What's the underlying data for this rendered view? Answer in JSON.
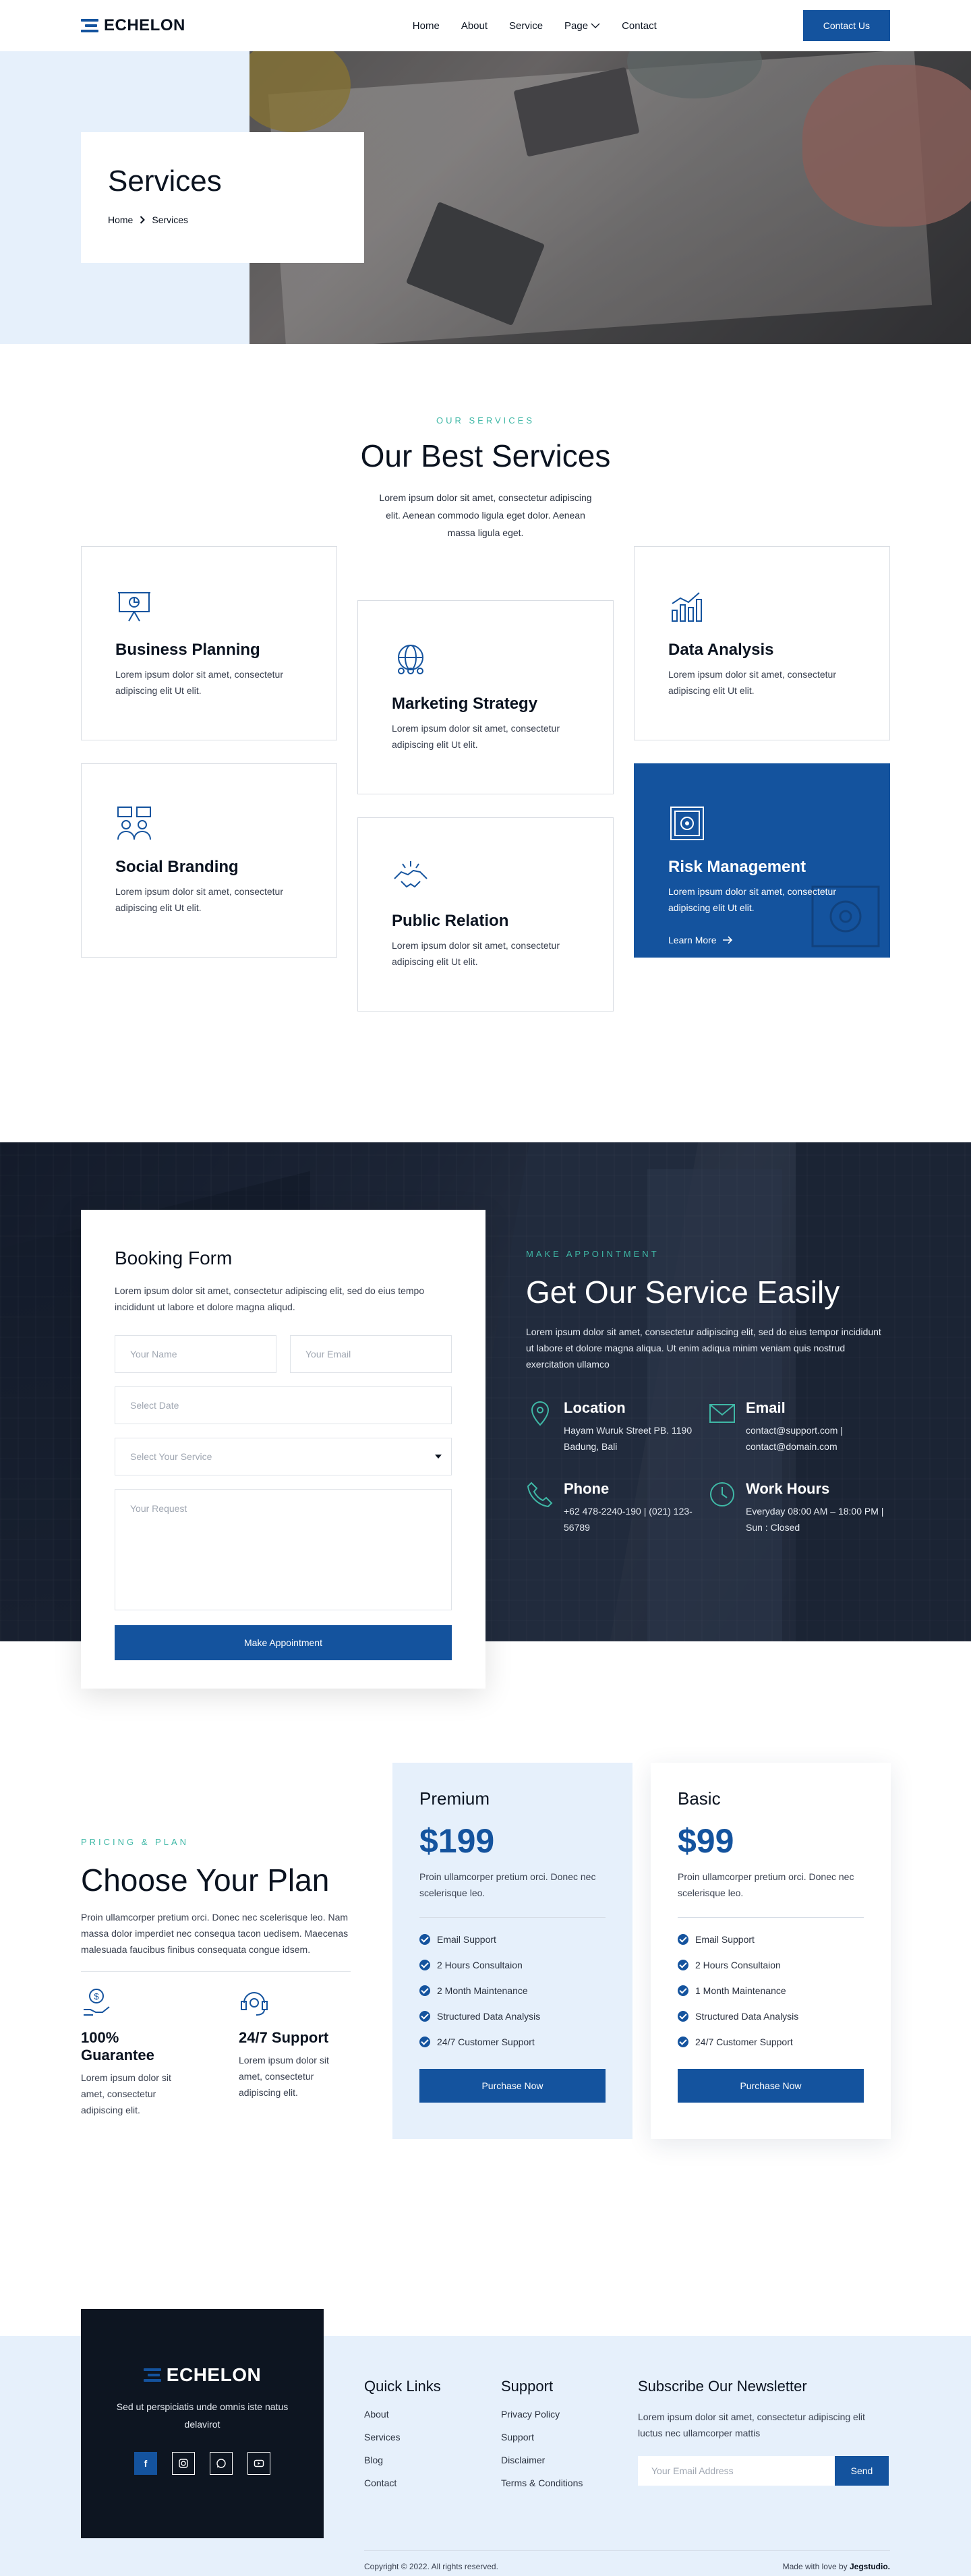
{
  "brand": {
    "name": "ECHELON"
  },
  "nav": {
    "items": [
      "Home",
      "About",
      "Service",
      "Page",
      "Contact"
    ],
    "cta": "Contact Us"
  },
  "hero": {
    "title": "Services",
    "crumb_home": "Home",
    "crumb_current": "Services"
  },
  "services": {
    "eyebrow": "OUR SERVICES",
    "title": "Our Best Services",
    "desc": "Lorem ipsum dolor sit amet, consectetur adipiscing elit. Aenean commodo ligula eget dolor. Aenean massa ligula eget.",
    "cards": [
      {
        "title": "Business Planning",
        "desc": "Lorem ipsum dolor sit amet, consectetur adipiscing elit Ut elit.",
        "icon": "presentation-icon"
      },
      {
        "title": "Marketing Strategy",
        "desc": "Lorem ipsum dolor sit amet, consectetur adipiscing elit Ut elit.",
        "icon": "globe-people-icon"
      },
      {
        "title": "Data Analysis",
        "desc": "Lorem ipsum dolor sit amet, consectetur adipiscing elit Ut elit.",
        "icon": "bar-chart-icon"
      },
      {
        "title": "Social Branding",
        "desc": "Lorem ipsum dolor sit amet, consectetur adipiscing elit Ut elit.",
        "icon": "team-chat-icon"
      },
      {
        "title": "Public Relation",
        "desc": "Lorem ipsum dolor sit amet, consectetur adipiscing elit Ut elit.",
        "icon": "handshake-icon"
      },
      {
        "title": "Risk Management",
        "desc": "Lorem ipsum dolor sit amet, consectetur adipiscing elit Ut elit.",
        "icon": "safe-icon",
        "link": "Learn More"
      }
    ]
  },
  "booking": {
    "title": "Booking Form",
    "desc": "Lorem ipsum dolor sit amet, consectetur adipiscing elit, sed do eius tempo  incididunt ut labore et dolore magna aliqud.",
    "name_ph": "Your Name",
    "email_ph": "Your Email",
    "date_ph": "Select Date",
    "service_ph": "Select Your Service",
    "request_ph": "Your Request",
    "submit": "Make Appointment"
  },
  "appointment": {
    "eyebrow": "MAKE APPOINTMENT",
    "title": "Get Our Service Easily",
    "desc": "Lorem ipsum dolor sit amet, consectetur adipiscing elit, sed do eius tempor incididunt ut labore et dolore magna aliqua. Ut enim adiqua minim veniam quis nostrud exercitation ullamco",
    "contacts": [
      {
        "title": "Location",
        "text": "Hayam Wuruk Street PB. 1190 Badung, Bali",
        "icon": "location-pin-icon"
      },
      {
        "title": "Email",
        "text": "contact@support.com | contact@domain.com",
        "icon": "mail-icon"
      },
      {
        "title": "Phone",
        "text": "+62 478-2240-190 | (021) 123-56789",
        "icon": "phone-icon"
      },
      {
        "title": "Work Hours",
        "text": "Everyday 08:00 AM – 18:00 PM | Sun : Closed",
        "icon": "clock-icon"
      }
    ]
  },
  "pricing": {
    "eyebrow": "PRICING & PLAN",
    "title": "Choose Your Plan",
    "desc": "Proin ullamcorper pretium orci. Donec nec scelerisque leo. Nam massa dolor imperdiet nec consequa tacon uedisem. Maecenas malesuada faucibus finibus consequata congue idsem.",
    "features": [
      {
        "title": "100% Guarantee",
        "desc": "Lorem ipsum dolor sit amet, consectetur adipiscing elit.",
        "icon": "money-hand-icon"
      },
      {
        "title": "24/7 Support",
        "desc": "Lorem ipsum dolor sit amet, consectetur adipiscing elit.",
        "icon": "support-headset-icon"
      }
    ],
    "plans": [
      {
        "name": "Premium",
        "price": "$199",
        "desc": "Proin ullamcorper pretium orci. Donec nec scelerisque leo.",
        "items": [
          "Email Support",
          "2 Hours Consultaion",
          "2 Month Maintenance",
          "Structured Data Analysis",
          "24/7 Customer Support"
        ],
        "cta": "Purchase Now"
      },
      {
        "name": "Basic",
        "price": "$99",
        "desc": "Proin ullamcorper pretium orci. Donec nec scelerisque leo.",
        "items": [
          "Email Support",
          "2 Hours Consultaion",
          "1 Month Maintenance",
          "Structured Data Analysis",
          "24/7 Customer Support"
        ],
        "cta": "Purchase Now"
      }
    ]
  },
  "footer": {
    "tagline": "Sed ut perspiciatis unde omnis iste natus delavirot",
    "socials": [
      "f",
      "ig",
      "wa",
      "yt"
    ],
    "quick_links": {
      "title": "Quick Links",
      "items": [
        "About",
        "Services",
        "Blog",
        "Contact"
      ]
    },
    "support": {
      "title": "Support",
      "items": [
        "Privacy Policy",
        "Support",
        "Disclaimer",
        "Terms & Conditions"
      ]
    },
    "newsletter": {
      "title": "Subscribe Our Newsletter",
      "desc": "Lorem ipsum dolor sit amet, consectetur adipiscing elit luctus nec ullamcorper mattis",
      "placeholder": "Your Email Address",
      "button": "Send"
    },
    "copyright": "Copyright © 2022. All rights reserved.",
    "made_by": "Made with love by",
    "made_by_name": "Jegstudio."
  },
  "colors": {
    "primary": "#14539e",
    "accent": "#3fb8a6",
    "dark": "#0d1521",
    "light_bg": "#e6f0fb"
  }
}
